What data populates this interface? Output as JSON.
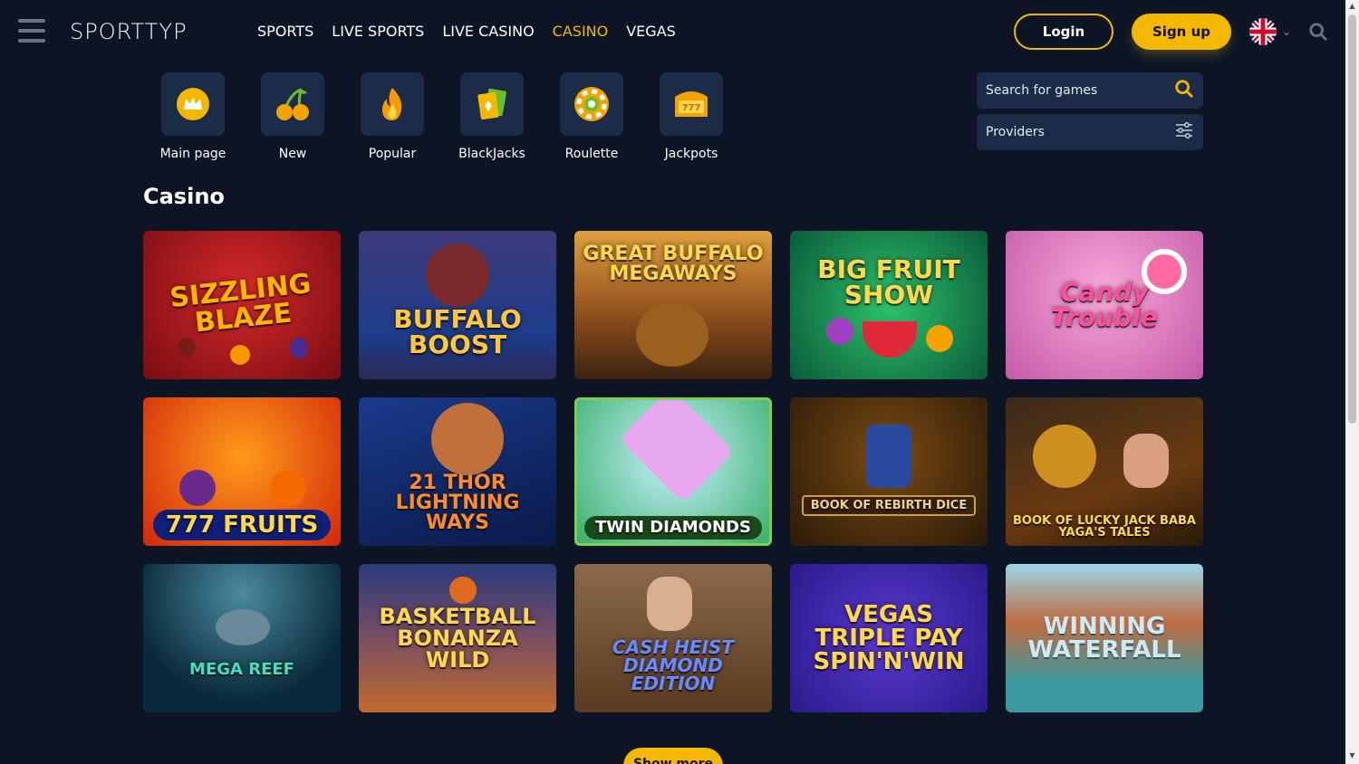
{
  "header": {
    "logo": "SPORTTYP",
    "nav": [
      "SPORTS",
      "LIVE SPORTS",
      "LIVE CASINO",
      "CASINO",
      "VEGAS"
    ],
    "active_nav": "CASINO",
    "login": "Login",
    "signup": "Sign up"
  },
  "categories": [
    {
      "label": "Main page",
      "icon": "crown-icon"
    },
    {
      "label": "New",
      "icon": "cherries-icon"
    },
    {
      "label": "Popular",
      "icon": "flame-icon"
    },
    {
      "label": "BlackJacks",
      "icon": "cards-icon"
    },
    {
      "label": "Roulette",
      "icon": "roulette-chip-icon"
    },
    {
      "label": "Jackpots",
      "icon": "jackpot-777-icon"
    }
  ],
  "search": {
    "placeholder": "Search for games",
    "providers": "Providers"
  },
  "section_title": "Casino",
  "games": [
    {
      "title": "Sizzling Blaze"
    },
    {
      "title": "Buffalo Boost"
    },
    {
      "title": "Great Buffalo Megaways"
    },
    {
      "title": "Big Fruit Show"
    },
    {
      "title": "Candy Trouble"
    },
    {
      "title": "777 Fruits"
    },
    {
      "title": "21 Thor Lightning Ways"
    },
    {
      "title": "Twin Diamonds"
    },
    {
      "title": "Book of Rebirth Dice"
    },
    {
      "title": "Book of Lucky Jack Baba Yaga's Tales"
    },
    {
      "title": "Mega Reef"
    },
    {
      "title": "Basketball Bonanza Wild"
    },
    {
      "title": "Cash Heist Diamond Edition"
    },
    {
      "title": "Vegas Triple Pay Spin'n'Win"
    },
    {
      "title": "Winning Waterfall"
    }
  ],
  "show_more": "Show more",
  "colors": {
    "accent": "#f5b800",
    "background": "#0d1524",
    "panel": "#1c2b47"
  }
}
